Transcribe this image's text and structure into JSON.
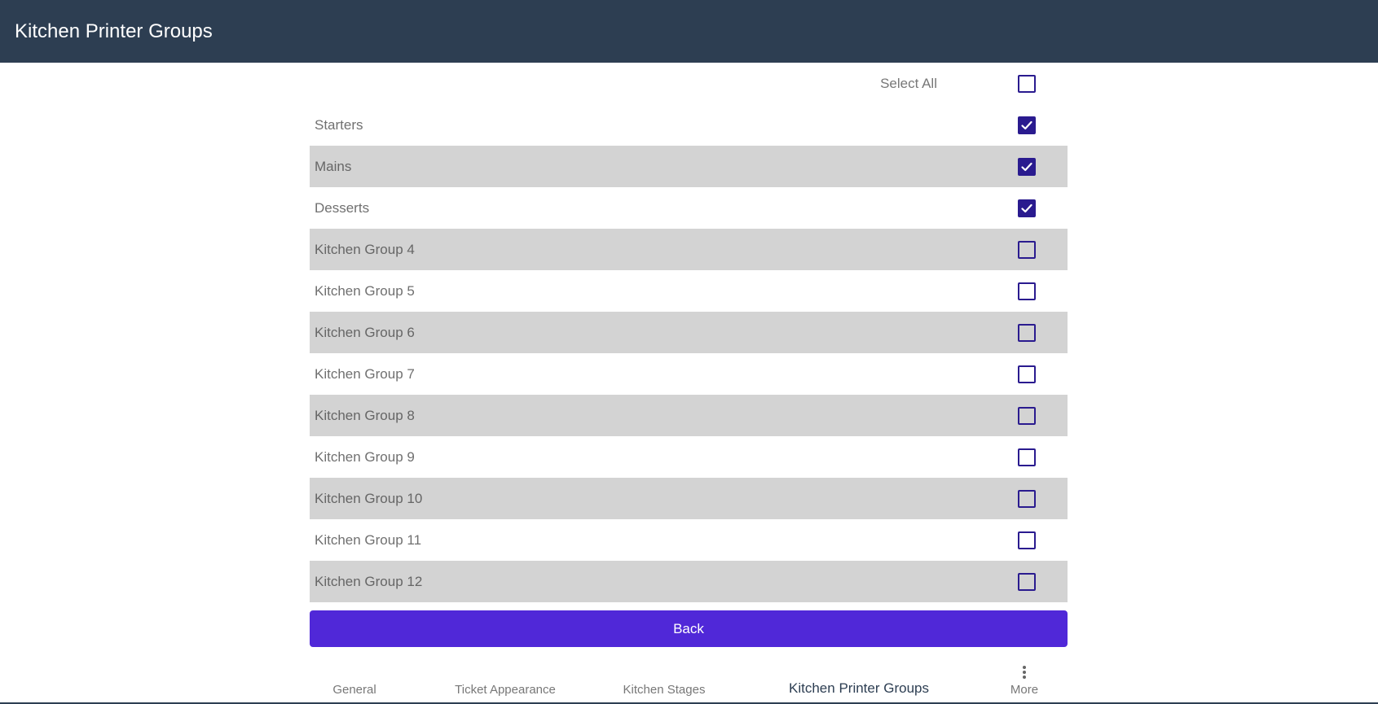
{
  "app_bar": {
    "title": "Kitchen Printer Groups"
  },
  "select_all": {
    "label": "Select All",
    "checked": false
  },
  "groups": [
    {
      "label": "Starters",
      "checked": true
    },
    {
      "label": "Mains",
      "checked": true
    },
    {
      "label": "Desserts",
      "checked": true
    },
    {
      "label": "Kitchen Group 4",
      "checked": false
    },
    {
      "label": "Kitchen Group 5",
      "checked": false
    },
    {
      "label": "Kitchen Group 6",
      "checked": false
    },
    {
      "label": "Kitchen Group 7",
      "checked": false
    },
    {
      "label": "Kitchen Group 8",
      "checked": false
    },
    {
      "label": "Kitchen Group 9",
      "checked": false
    },
    {
      "label": "Kitchen Group 10",
      "checked": false
    },
    {
      "label": "Kitchen Group 11",
      "checked": false
    },
    {
      "label": "Kitchen Group 12",
      "checked": false
    }
  ],
  "back_button": {
    "label": "Back"
  },
  "bottom_nav": {
    "items": [
      {
        "label": "General",
        "active": false
      },
      {
        "label": "Ticket Appearance",
        "active": false
      },
      {
        "label": "Kitchen Stages",
        "active": false
      },
      {
        "label": "Kitchen Printer Groups",
        "active": true
      },
      {
        "label": "More",
        "active": false,
        "icon": "more-vertical-icon"
      }
    ]
  },
  "colors": {
    "app_bar": "#2d3e52",
    "checkbox": "#2a1b8f",
    "button": "#5028d8",
    "row_alt": "#d3d3d3"
  }
}
